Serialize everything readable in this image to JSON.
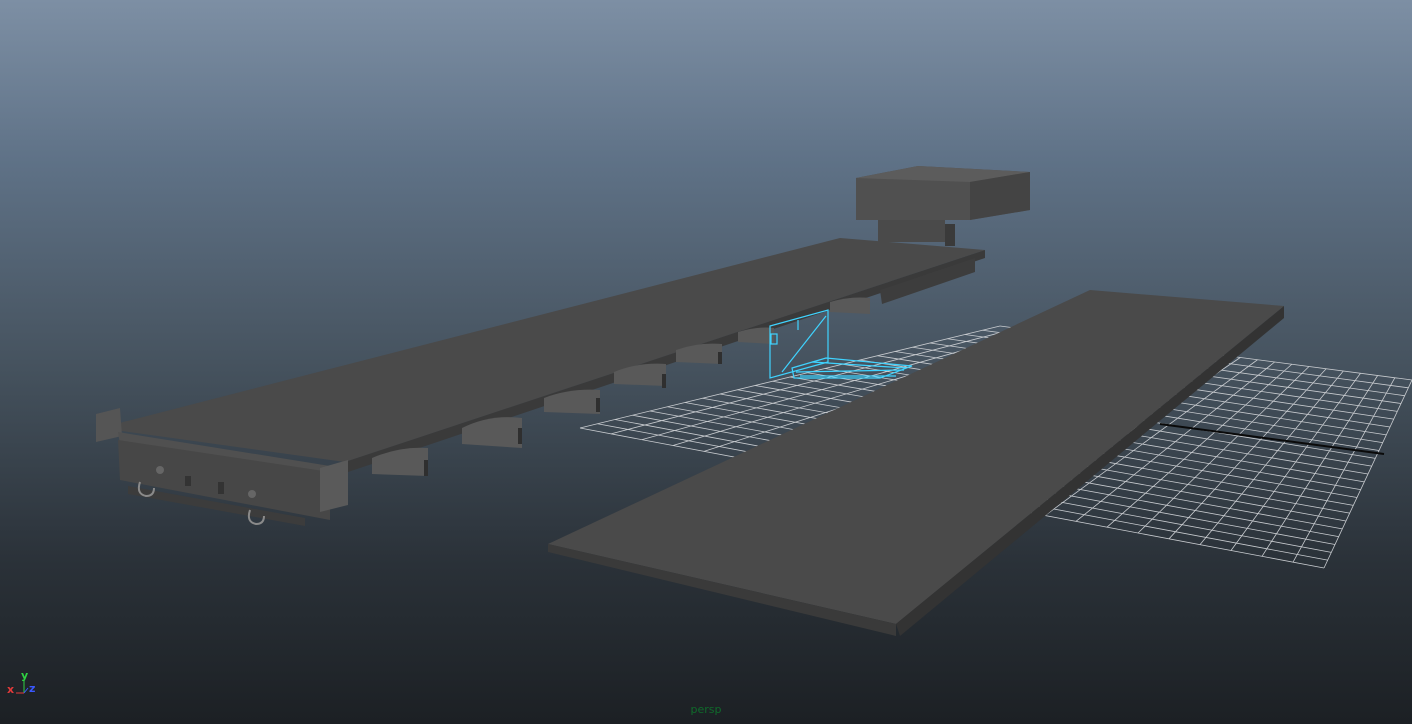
{
  "viewport": {
    "camera": "persp",
    "axes": {
      "x": "x",
      "y": "y",
      "z": "z"
    },
    "colors": {
      "background_top": "#7d8fa4",
      "background_bottom": "#1c2024",
      "mesh_gray": "#4a4a4a",
      "grid_line": "#c9ccd0",
      "grid_axis": "#0a0a0a",
      "selection": "#3fd3ff",
      "camera_label": "#0f6b2b",
      "axis_x": "#e23a3a",
      "axis_y": "#2fd042",
      "axis_z": "#3a58ff"
    },
    "objects": [
      "railcar-underframe-mesh",
      "deck-plate-mesh",
      "selected-panel-mesh",
      "ground-grid"
    ]
  }
}
